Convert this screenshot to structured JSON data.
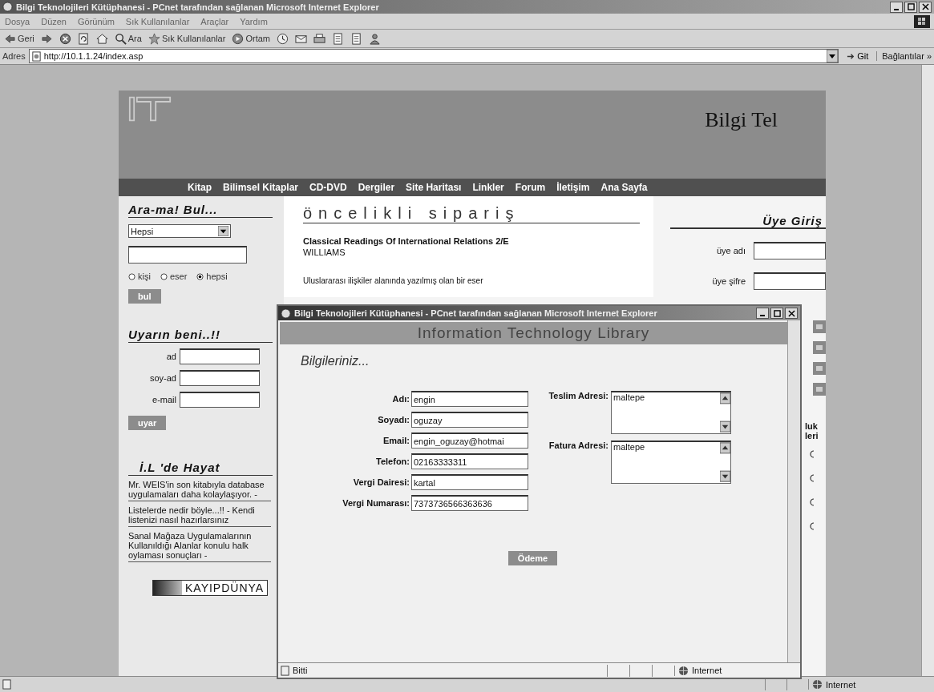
{
  "window": {
    "title": "Bilgi Teknolojileri Kütüphanesi - PCnet tarafından sağlanan Microsoft Internet Explorer"
  },
  "menu": [
    "Dosya",
    "Düzen",
    "Görünüm",
    "Sık Kullanılanlar",
    "Araçlar",
    "Yardım"
  ],
  "toolbar": [
    {
      "kind": "back",
      "label": "Geri"
    },
    {
      "kind": "forward"
    },
    {
      "kind": "stop"
    },
    {
      "kind": "refresh"
    },
    {
      "kind": "home"
    },
    {
      "kind": "search",
      "label": "Ara"
    },
    {
      "kind": "favorites",
      "label": "Sık Kullanılanlar"
    },
    {
      "kind": "media",
      "label": "Ortam"
    },
    {
      "kind": "history"
    },
    {
      "kind": "mail"
    },
    {
      "kind": "print"
    },
    {
      "kind": "edit"
    },
    {
      "kind": "page"
    },
    {
      "kind": "person"
    }
  ],
  "address": {
    "label": "Adres",
    "url": "http://10.1.1.24/index.asp",
    "go": "Git",
    "links": "Bağlantılar »"
  },
  "page": {
    "brand": "Bilgi Tel",
    "nav": [
      "Kitap",
      "Bilimsel Kitaplar",
      "CD-DVD",
      "Dergiler",
      "Site Haritası",
      "Linkler",
      "Forum",
      "İletişim",
      "Ana Sayfa"
    ],
    "search": {
      "heading": "Ara-ma! Bul...",
      "category": "Hepsi",
      "options": [
        {
          "label": "kişi",
          "selected": false
        },
        {
          "label": "eser",
          "selected": false
        },
        {
          "label": "hepsi",
          "selected": true
        }
      ],
      "button": "bul"
    },
    "alert": {
      "heading": "Uyarın beni..!!",
      "fields": [
        "ad",
        "soy-ad",
        "e-mail"
      ],
      "button": "uyar"
    },
    "life": {
      "heading": "İ.L 'de Hayat",
      "links": [
        "Mr. WEIS'in son kitabıyla database uygulamaları daha kolaylaşıyor. -",
        "Listelerde nedir böyle...!! - Kendi listenizi nasıl hazırlarsınız",
        "Sanal Mağaza Uygulamalarının Kullanıldığı Alanlar konulu halk oylaması sonuçları -"
      ],
      "banner": "KAYIPDÜNYA"
    },
    "featured": {
      "heading": "öncelikli sipariş",
      "title": "Classical Readings Of International Relations 2/E",
      "author": "WILLIAMS",
      "description": "Uluslararası ilişkiler alanında yazılmış olan bir eser"
    },
    "login": {
      "heading": "Üye Giriş",
      "fields": [
        "üye adı",
        "üye şifre"
      ]
    },
    "right_fragments": [
      "luk",
      "leri"
    ]
  },
  "popup": {
    "title": "Bilgi Teknolojileri Kütüphanesi - PCnet tarafından sağlanan Microsoft Internet Explorer",
    "banner": "Information Technology Library",
    "heading": "Bilgileriniz...",
    "fields": [
      {
        "label": "Adı:",
        "value": "engin"
      },
      {
        "label": "Soyadı:",
        "value": "oguzay"
      },
      {
        "label": "Email:",
        "value": "engin_oguzay@hotmai"
      },
      {
        "label": "Telefon:",
        "value": "02163333311"
      },
      {
        "label": "Vergi Dairesi:",
        "value": "kartal"
      },
      {
        "label": "Vergi Numarası:",
        "value": "7373736566363636"
      }
    ],
    "addresses": [
      {
        "label": "Teslim Adresi:",
        "value": "maltepe"
      },
      {
        "label": "Fatura Adresi:",
        "value": "maltepe"
      }
    ],
    "button": "Ödeme",
    "status": "Bitti",
    "zone": "Internet"
  },
  "status_bar": {
    "zone": "Internet"
  }
}
